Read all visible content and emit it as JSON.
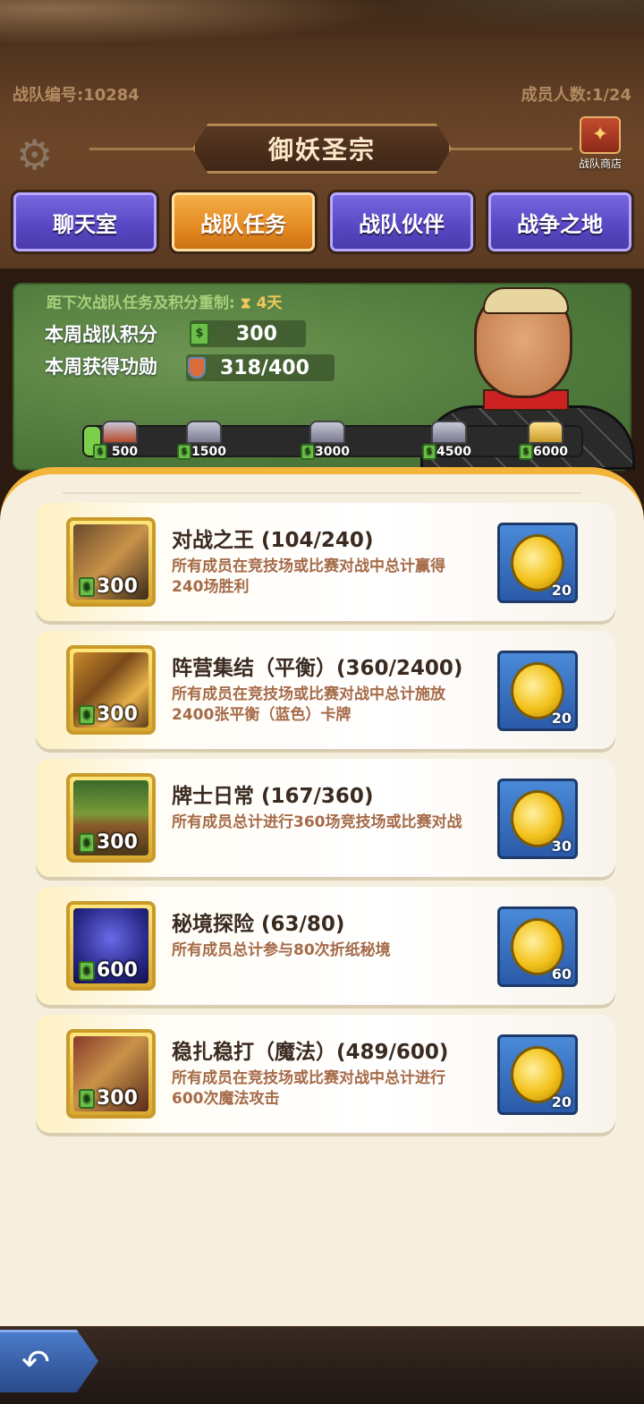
{
  "header": {
    "team_id": "战队编号:10284",
    "member_count": "成员人数:1/24",
    "title": "御妖圣宗",
    "shop_label": "战队商店"
  },
  "tabs": [
    {
      "label": "聊天室",
      "active": false
    },
    {
      "label": "战队任务",
      "active": true
    },
    {
      "label": "战队伙伴",
      "active": false
    },
    {
      "label": "战争之地",
      "active": false
    }
  ],
  "board": {
    "reset_text": "距下次战队任务及积分重制:",
    "reset_days": "4天",
    "weekly_points_label": "本周战队积分",
    "weekly_points_value": "300",
    "weekly_merit_label": "本周获得功勋",
    "weekly_merit_value": "318/400",
    "progress_fraction": 0.0,
    "milestones": [
      "500",
      "1500",
      "3000",
      "4500",
      "6000"
    ]
  },
  "tasks": [
    {
      "title": "对战之王 (104/240)",
      "desc": "所有成员在竞技场或比赛对战中总计赢得240场胜利",
      "points": "300",
      "reward_qty": "20",
      "icon": "barrel-icon"
    },
    {
      "title": "阵营集结（平衡）(360/2400)",
      "desc": "所有成员在竞技场或比赛对战中总计施放2400张平衡（蓝色）卡牌",
      "points": "300",
      "reward_qty": "20",
      "icon": "cards-icon"
    },
    {
      "title": "牌士日常 (167/360)",
      "desc": "所有成员总计进行360场竞技场或比赛对战",
      "points": "300",
      "reward_qty": "30",
      "icon": "table-icon"
    },
    {
      "title": "秘境探险 (63/80)",
      "desc": "所有成员总计参与80次折纸秘境",
      "points": "600",
      "reward_qty": "60",
      "icon": "castle-icon"
    },
    {
      "title": "稳扎稳打（魔法）(489/600)",
      "desc": "所有成员在竞技场或比赛对战中总计进行600次魔法攻击",
      "points": "300",
      "reward_qty": "20",
      "icon": "crossbow-icon"
    }
  ]
}
